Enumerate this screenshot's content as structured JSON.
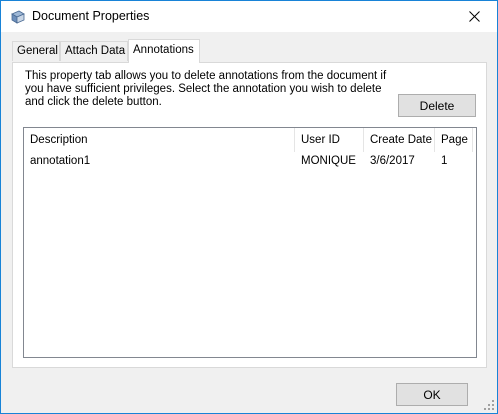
{
  "window": {
    "title": "Document Properties"
  },
  "tabs": [
    {
      "label": "General"
    },
    {
      "label": "Attach Data"
    },
    {
      "label": "Annotations"
    }
  ],
  "annotations_tab": {
    "description": "This property tab allows you to delete annotations from the document if you have sufficient privileges.  Select the annotation you wish to delete and click the delete button.",
    "delete_label": "Delete",
    "columns": [
      "Description",
      "User ID",
      "Create Date",
      "Page"
    ],
    "rows": [
      {
        "description": "annotation1",
        "user_id": "MONIQUE",
        "create_date": "3/6/2017",
        "page": "1"
      }
    ]
  },
  "footer": {
    "ok_label": "OK"
  },
  "icons": {
    "app": "document-properties-icon",
    "close": "close-icon",
    "resize": "size-grip-icon"
  }
}
